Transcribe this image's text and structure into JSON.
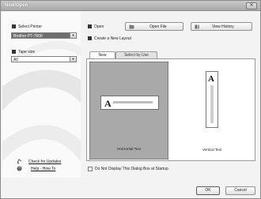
{
  "window": {
    "title": "New/Open",
    "close_glyph": "✕"
  },
  "left": {
    "printer_label": "Select Printer",
    "printer_value": "Brother PT-7600",
    "tape_label": "Tape size",
    "tape_value": "All",
    "updates_link": "Check for Updates",
    "help_link": "Help - How To"
  },
  "right": {
    "open_label": "Open",
    "open_file_button": "Open File",
    "view_history_button": "View History",
    "create_label": "Create a New Layout",
    "tabs": [
      {
        "label": "New"
      },
      {
        "label": "Select by Use"
      }
    ],
    "layouts": [
      {
        "caption": "Horizontal Text",
        "glyph": "A"
      },
      {
        "caption": "Vertical Text",
        "glyph": "A"
      }
    ],
    "dont_display_label": "Do Not Display This Dialog Box at Startup"
  },
  "footer": {
    "ok_button": "OK",
    "cancel_button": "Cancel"
  },
  "icons": [
    "printer-icon",
    "tape-icon",
    "open-folder-icon",
    "open-file-icon",
    "view-history-icon",
    "new-layout-icon",
    "updates-icon",
    "help-icon"
  ],
  "colors": {
    "selected_card": "#a9a9a9",
    "titlebar": "#b8b8b8"
  }
}
